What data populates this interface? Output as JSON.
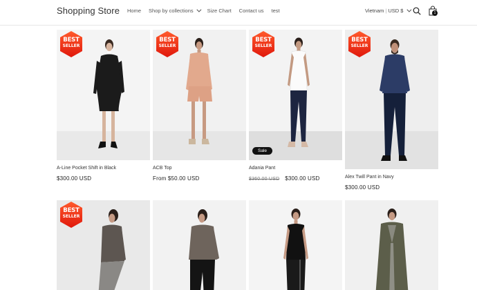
{
  "header": {
    "logo": "Shopping Store",
    "nav": [
      {
        "label": "Home",
        "dropdown": false
      },
      {
        "label": "Shop by collections",
        "dropdown": true
      },
      {
        "label": "Size Chart",
        "dropdown": false
      },
      {
        "label": "Contact us",
        "dropdown": false
      },
      {
        "label": "test",
        "dropdown": false
      }
    ],
    "locale": {
      "country": "Vietnam",
      "currency": "USD $"
    },
    "cart_count": "1"
  },
  "badge": {
    "line1": "BEST",
    "line2": "SELLER"
  },
  "products": [
    {
      "title": "A-Line Pocket Shift in Black",
      "price": "$300.00 USD",
      "compare_price": "",
      "sale": "",
      "best_seller": true
    },
    {
      "title": "ACB Top",
      "price": "From $50.00 USD",
      "compare_price": "",
      "sale": "",
      "best_seller": true
    },
    {
      "title": "Adania Pant",
      "price": "$300.00 USD",
      "compare_price": "$360.00 USD",
      "sale": "Sale",
      "best_seller": true
    },
    {
      "title": "Alex Twill Pant in Navy",
      "price": "$300.00 USD",
      "compare_price": "",
      "sale": "",
      "best_seller": true
    },
    {
      "title": "",
      "price": "",
      "compare_price": "",
      "sale": "",
      "best_seller": true
    },
    {
      "title": "",
      "price": "",
      "compare_price": "",
      "sale": "",
      "best_seller": false
    },
    {
      "title": "",
      "price": "",
      "compare_price": "",
      "sale": "",
      "best_seller": false
    },
    {
      "title": "",
      "price": "",
      "compare_price": "",
      "sale": "",
      "best_seller": false
    }
  ],
  "colors": {
    "badge_top": "#ff4d2e",
    "badge_bottom": "#e01e0e",
    "text": "#121212"
  }
}
